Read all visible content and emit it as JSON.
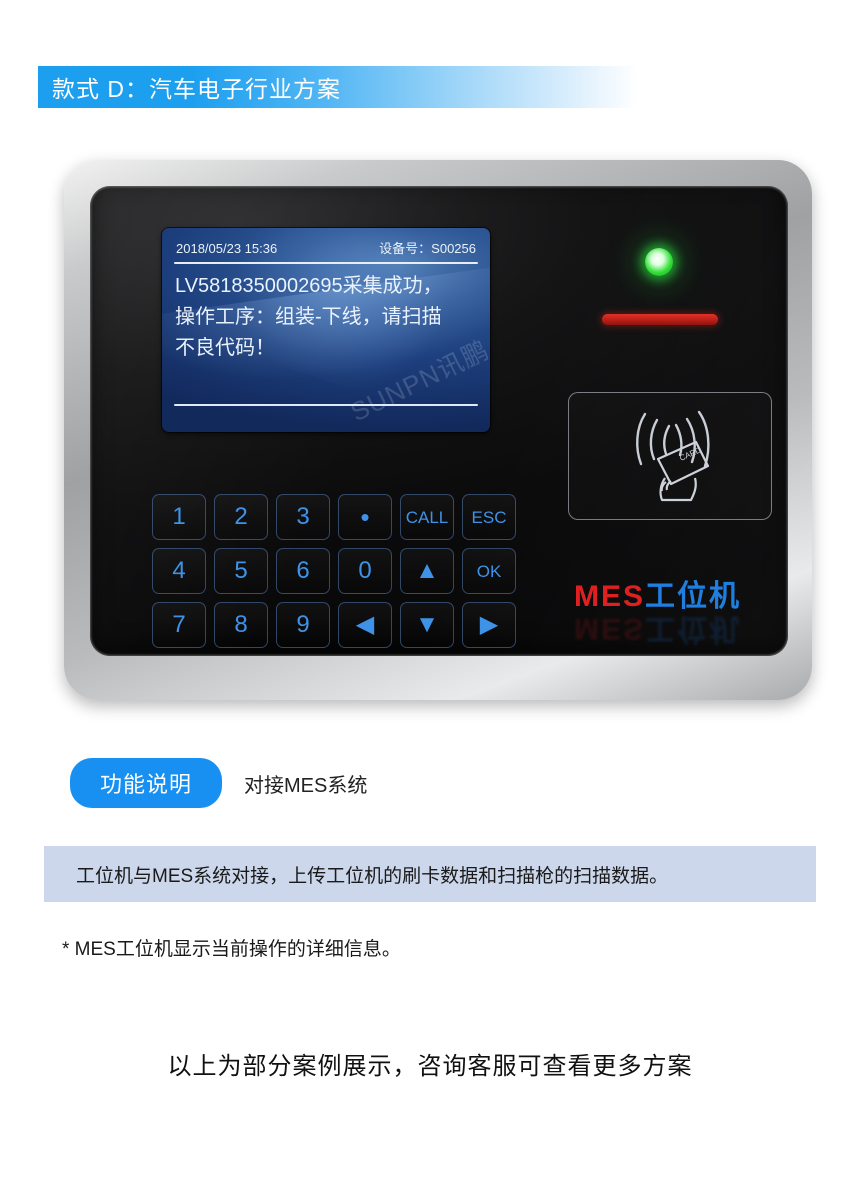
{
  "header": {
    "title": "款式 D：汽车电子行业方案",
    "bar_color": "#1d9ff0"
  },
  "device": {
    "bezel_color": "#b9bbbd",
    "panel_color": "#101011",
    "lcd": {
      "datetime": "2018/05/23  15:36",
      "device_no_label": "设备号：S00256",
      "message_line1": "LV5818350002695采集成功，",
      "message_line2": "操作工序：组装-下线，请扫描",
      "message_line3": "不良代码！",
      "watermark": "SUNPN讯鹏",
      "screen_color": "#2f5896"
    },
    "indicators": {
      "led_name": "status-led",
      "led_color": "#35e03a",
      "scanner_strip_color": "#c32219"
    },
    "rfid": {
      "card_text": "CARD",
      "icon_name": "rfid-wave-card-icon"
    },
    "brand": {
      "prefix": "MES",
      "prefix_color": "#e02020",
      "suffix": "工位机",
      "suffix_color": "#1f7fe0"
    },
    "keypad": {
      "key_color": "#3e93e8",
      "keys": [
        {
          "label": "1",
          "name": "key-1",
          "style": "num"
        },
        {
          "label": "2",
          "name": "key-2",
          "style": "num"
        },
        {
          "label": "3",
          "name": "key-3",
          "style": "num"
        },
        {
          "label": "•",
          "name": "key-dot",
          "style": "dot"
        },
        {
          "label": "CALL",
          "name": "key-call",
          "style": "small"
        },
        {
          "label": "ESC",
          "name": "key-esc",
          "style": "small"
        },
        {
          "label": "4",
          "name": "key-4",
          "style": "num"
        },
        {
          "label": "5",
          "name": "key-5",
          "style": "num"
        },
        {
          "label": "6",
          "name": "key-6",
          "style": "num"
        },
        {
          "label": "0",
          "name": "key-0",
          "style": "num"
        },
        {
          "label": "▲",
          "name": "key-arrow-up",
          "style": "tri"
        },
        {
          "label": "OK",
          "name": "key-ok",
          "style": "small"
        },
        {
          "label": "7",
          "name": "key-7",
          "style": "num"
        },
        {
          "label": "8",
          "name": "key-8",
          "style": "num"
        },
        {
          "label": "9",
          "name": "key-9",
          "style": "num"
        },
        {
          "label": "◀",
          "name": "key-arrow-left",
          "style": "tri"
        },
        {
          "label": "▼",
          "name": "key-arrow-down",
          "style": "tri"
        },
        {
          "label": "▶",
          "name": "key-arrow-right",
          "style": "tri"
        }
      ]
    }
  },
  "function_section": {
    "badge_label": "功能说明",
    "badge_color": "#1890f2",
    "summary": "对接MES系统"
  },
  "info_box": {
    "text": "工位机与MES系统对接，上传工位机的刷卡数据和扫描枪的扫描数据。",
    "background_color": "#ccd7ec"
  },
  "note": "* MES工位机显示当前操作的详细信息。",
  "footer": "以上为部分案例展示，咨询客服可查看更多方案"
}
